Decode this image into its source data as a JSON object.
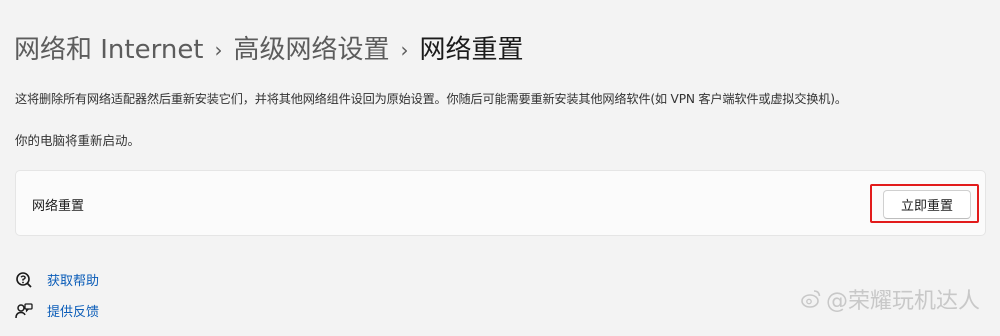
{
  "breadcrumb": {
    "items": [
      "网络和 Internet",
      "高级网络设置",
      "网络重置"
    ],
    "separator": "›"
  },
  "description": "这将删除所有网络适配器然后重新安装它们，并将其他网络组件设回为原始设置。你随后可能需要重新安装其他网络软件(如 VPN 客户端软件或虚拟交换机)。",
  "restart_note": "你的电脑将重新启动。",
  "reset_card": {
    "label": "网络重置",
    "button_label": "立即重置"
  },
  "links": {
    "help": {
      "label": "获取帮助",
      "icon": "help-icon"
    },
    "feedback": {
      "label": "提供反馈",
      "icon": "feedback-icon"
    }
  },
  "watermark": "@荣耀玩机达人",
  "colors": {
    "link": "#0a5cb8",
    "highlight_border": "#e21b1b",
    "background": "#f3f3f3"
  }
}
